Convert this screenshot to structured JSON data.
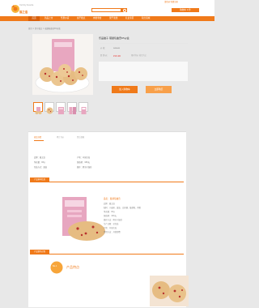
{
  "header": {
    "brand_name": "猫之语",
    "brand_tagline": "Yummy Snacks",
    "login": "请登录 免费注册",
    "cart": "购物车 0 件"
  },
  "nav": {
    "items": [
      "首页",
      "新品上市",
      "坚果炒货",
      "饼干糕点",
      "肉类零食",
      "果干蜜饯",
      "礼盒专区",
      "积分商城"
    ]
  },
  "breadcrumb": "首页 > 饼干糕点 > 蔓越莓曲奇65g/盒",
  "product": {
    "title": "乐品猫子 蔓越莓曲奇65g/盒",
    "price_label": "价 格：",
    "price_value": "¥28.00",
    "promo_label": "促 销 价：",
    "promo_value": "¥19.90",
    "promo_note": "限时特价 抢完为止",
    "buy_label": "加入购物车",
    "cart_label": "立即购买"
  },
  "tabs": [
    "商品详情",
    "累计评价",
    "售后保障"
  ],
  "attributes": [
    {
      "k": "品牌：猫之语",
      "v": "产地：中国大陆"
    },
    {
      "k": "净含量：65g",
      "v": "保质期：180天"
    },
    {
      "k": "包装方式：盒装",
      "v": "储存：阴凉干燥处"
    }
  ],
  "sections": {
    "info": "产品基本信息",
    "process": "产品制作过程"
  },
  "specs": {
    "title": "品名：蔓越莓曲奇",
    "lines": [
      "品牌：猫之语",
      "配料：小麦粉、黄油、白砂糖、蔓越莓、鸡蛋",
      "净含量：65g",
      "保质期：180天",
      "储存方法：阴凉干燥处",
      "生产日期：见包装",
      "产地：中国大陆",
      "食用方法：开袋即食"
    ]
  },
  "feature": {
    "badge": "No.1",
    "title": "产品特点"
  },
  "colors": {
    "accent": "#f07a1a",
    "price_red": "#e8322f"
  }
}
